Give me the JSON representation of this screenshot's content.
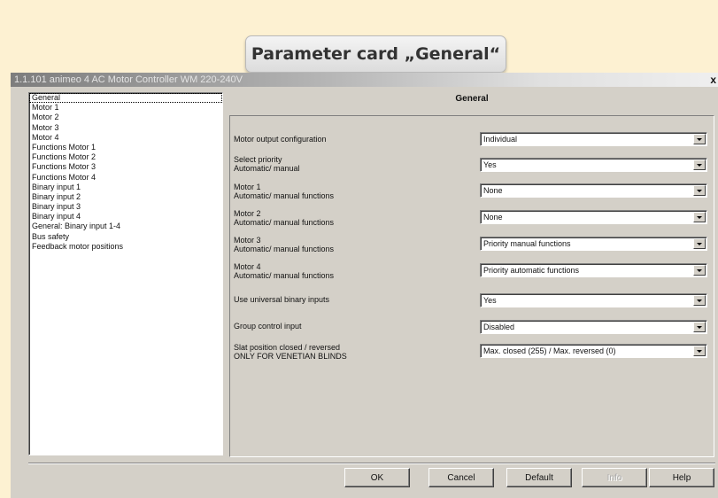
{
  "card_title": "Parameter card „General“",
  "window": {
    "title": "1.1.101 animeo 4 AC Motor Controller WM 220-240V",
    "close_label": "x"
  },
  "sidebar": {
    "items": [
      {
        "label": "General",
        "selected": true
      },
      {
        "label": "Motor 1"
      },
      {
        "label": "Motor 2"
      },
      {
        "label": "Motor 3"
      },
      {
        "label": "Motor 4"
      },
      {
        "label": "Functions Motor 1"
      },
      {
        "label": "Functions Motor 2"
      },
      {
        "label": "Functions Motor 3"
      },
      {
        "label": "Functions Motor 4"
      },
      {
        "label": "Binary input 1"
      },
      {
        "label": "Binary input 2"
      },
      {
        "label": "Binary input 3"
      },
      {
        "label": "Binary input 4"
      },
      {
        "label": "General: Binary input 1-4"
      },
      {
        "label": "Bus safety"
      },
      {
        "label": "Feedback motor positions"
      }
    ]
  },
  "panel": {
    "title": "General",
    "params": [
      {
        "label1": "Motor output configuration",
        "label2": "",
        "value": "Individual"
      },
      {
        "label1": "Select priority",
        "label2": "Automatic/ manual",
        "value": "Yes"
      },
      {
        "label1": "Motor 1",
        "label2": "Automatic/ manual functions",
        "value": "None"
      },
      {
        "label1": "Motor 2",
        "label2": "Automatic/ manual functions",
        "value": "None"
      },
      {
        "label1": "Motor 3",
        "label2": "Automatic/ manual functions",
        "value": "Priority manual functions"
      },
      {
        "label1": "Motor 4",
        "label2": "Automatic/ manual functions",
        "value": "Priority automatic functions"
      },
      {
        "label1": "Use universal binary inputs",
        "label2": "",
        "value": "Yes"
      },
      {
        "label1": "Group control input",
        "label2": "",
        "value": "Disabled"
      },
      {
        "label1": "Slat position closed / reversed",
        "label2": "ONLY FOR VENETIAN BLINDS",
        "value": "Max. closed (255) / Max. reversed (0)"
      }
    ]
  },
  "buttons": {
    "ok": "OK",
    "cancel": "Cancel",
    "default": "Default",
    "info": "Info",
    "help": "Help"
  }
}
